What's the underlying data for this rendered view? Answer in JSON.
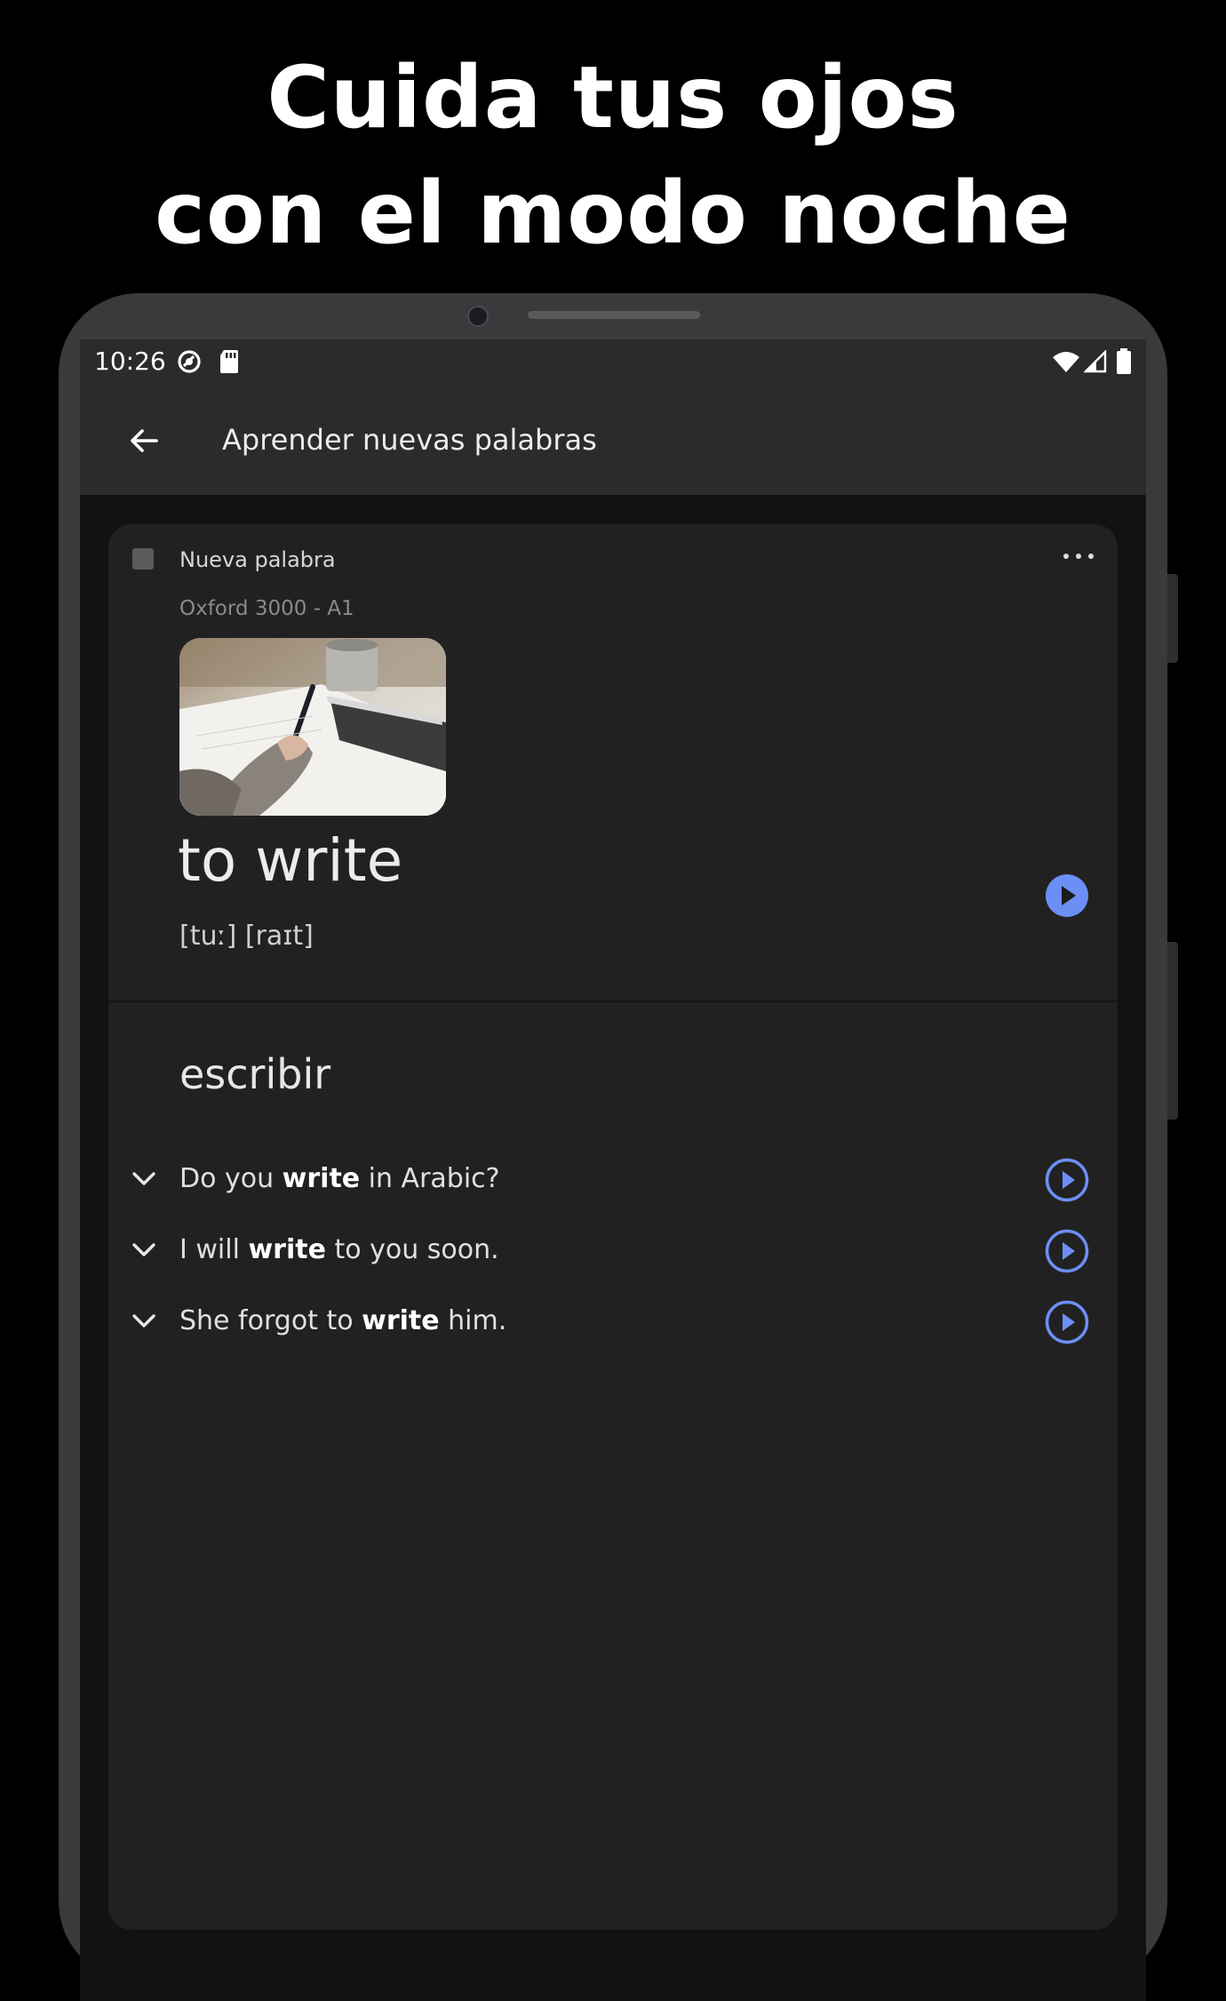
{
  "promo": {
    "line1": "Cuida tus ojos",
    "line2": "con el modo noche"
  },
  "status_bar": {
    "time": "10:26"
  },
  "app_bar": {
    "title": "Aprender nuevas palabras"
  },
  "card": {
    "status_label": "Nueva palabra",
    "source": "Oxford 3000 - A1",
    "word": "to write",
    "phonetic": "[tuː] [raɪt]",
    "translation": "escribir",
    "examples": [
      {
        "before": "Do you ",
        "bold": "write",
        "after": " in Arabic?"
      },
      {
        "before": "I will ",
        "bold": "write",
        "after": " to you soon."
      },
      {
        "before": "She forgot to ",
        "bold": "write",
        "after": " him."
      }
    ]
  },
  "colors": {
    "background": "#000000",
    "card": "#212121",
    "accent": "#6c8ff5"
  }
}
